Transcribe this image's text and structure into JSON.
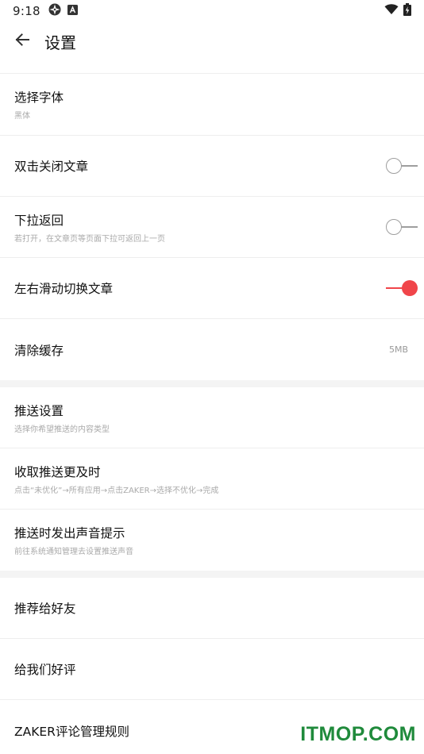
{
  "status_bar": {
    "time": "9:18",
    "icons": [
      "app-icon",
      "a-badge-icon"
    ],
    "right_icons": [
      "wifi-icon",
      "battery-charging-icon"
    ]
  },
  "app_bar": {
    "back_icon": "arrow-left-icon",
    "title": "设置"
  },
  "sections": [
    {
      "items": [
        {
          "label": "选择字体",
          "sub": "黑体"
        },
        {
          "label": "双击关闭文章",
          "toggle": false
        },
        {
          "label": "下拉返回",
          "sub": "若打开，在文章页等页面下拉可返回上一页",
          "toggle": false
        },
        {
          "label": "左右滑动切换文章",
          "toggle": true
        },
        {
          "label": "清除缓存",
          "value": "5MB"
        }
      ]
    },
    {
      "items": [
        {
          "label": "推送设置",
          "sub": "选择你希望推送的内容类型"
        },
        {
          "label": "收取推送更及时",
          "sub": "点击“未优化”→所有应用→点击ZAKER→选择不优化→完成"
        },
        {
          "label": "推送时发出声音提示",
          "sub": "前往系统通知管理去设置推送声音"
        }
      ]
    },
    {
      "items": [
        {
          "label": "推荐给好友"
        },
        {
          "label": "给我们好评"
        },
        {
          "label": "ZAKER评论管理规则"
        }
      ]
    }
  ],
  "colors": {
    "accent": "#f0454a",
    "toggle_off": "#9e9e9e",
    "divider": "#eeeeee",
    "section_gap": "#f4f4f4",
    "watermark": "#1f8a3b"
  },
  "watermark": "ITMOP.COM"
}
